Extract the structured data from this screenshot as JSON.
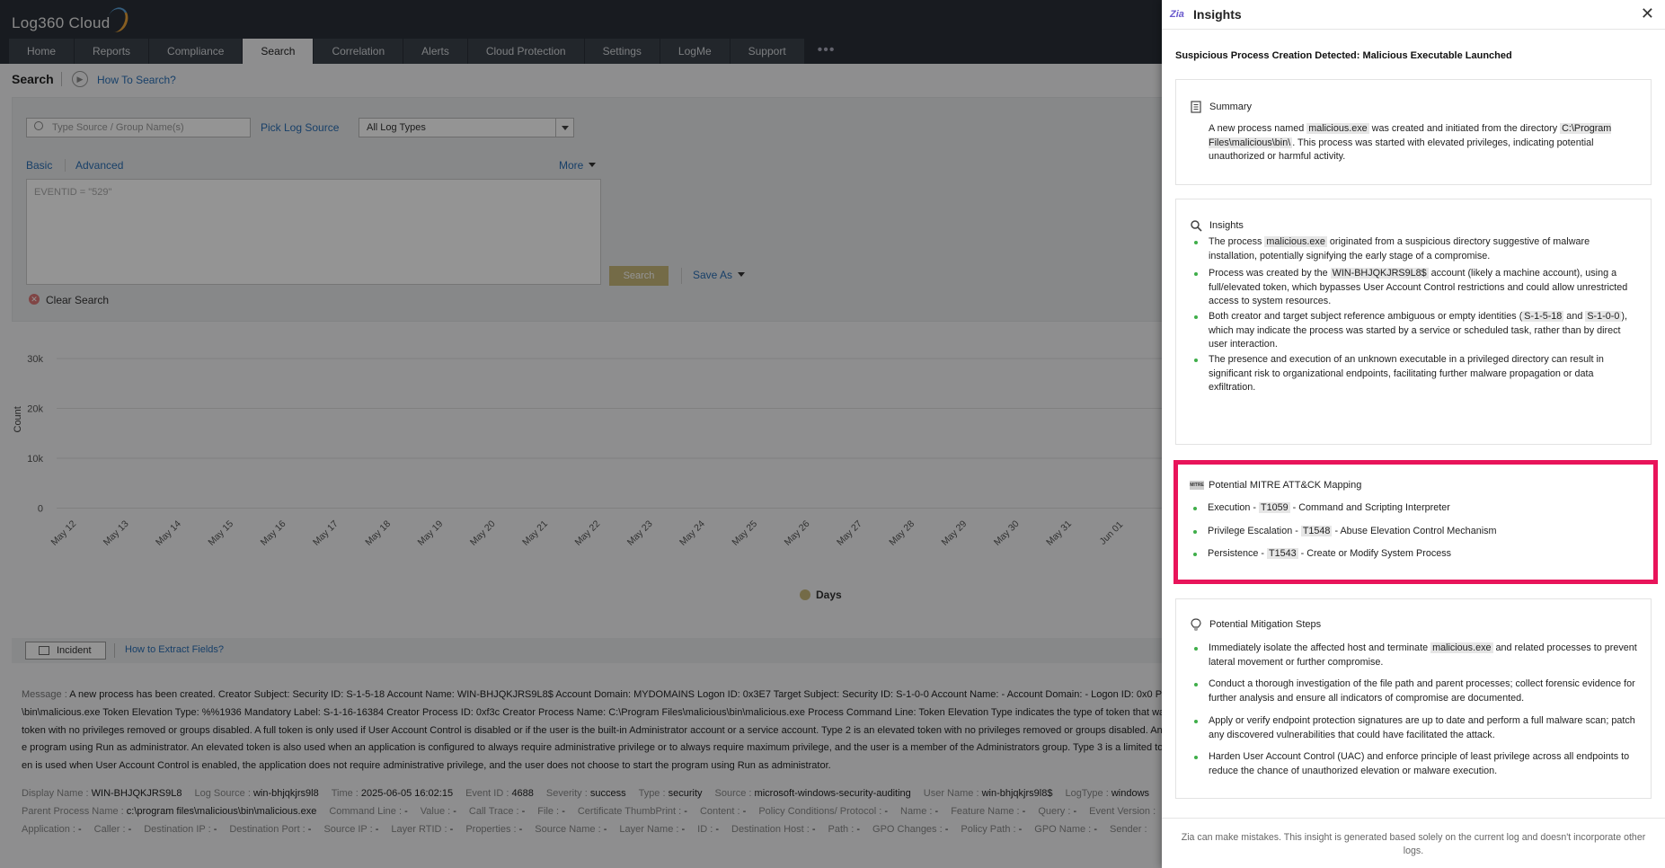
{
  "app": {
    "logo": "Log360 Cloud",
    "nav": [
      "Home",
      "Reports",
      "Compliance",
      "Search",
      "Correlation",
      "Alerts",
      "Cloud Protection",
      "Settings",
      "LogMe",
      "Support"
    ],
    "active_nav": "Search",
    "page_title": "Search",
    "how_to_search": "How To Search?"
  },
  "search": {
    "source_placeholder": "Type Source / Group Name(s)",
    "pick_log_source": "Pick Log Source",
    "log_type": "All Log Types",
    "mode_basic": "Basic",
    "mode_advanced": "Advanced",
    "more": "More",
    "query": "EVENTID = \"529\"",
    "search_button": "Search",
    "save_as": "Save As",
    "clear_search": "Clear Search"
  },
  "chart_data": {
    "type": "line",
    "ylabel": "Count",
    "xlabel": "Days",
    "ylim": [
      0,
      30000
    ],
    "yticks": [
      "30k",
      "20k",
      "10k",
      "0"
    ],
    "categories": [
      "May 12",
      "May 13",
      "May 14",
      "May 15",
      "May 16",
      "May 17",
      "May 18",
      "May 19",
      "May 20",
      "May 21",
      "May 22",
      "May 23",
      "May 24",
      "May 25",
      "May 26",
      "May 27",
      "May 28",
      "May 29",
      "May 30",
      "May 31",
      "Jun 01"
    ],
    "legend": [
      "Days"
    ],
    "grid": true
  },
  "incident": {
    "button": "Incident",
    "extract_link": "How to Extract Fields?"
  },
  "log": {
    "message_key": "Message",
    "message_lines": [
      "A new process has been created. Creator Subject: Security ID: S-1-5-18 Account Name: WIN-BHJQKJRS9L8$ Account Domain: MYDOMAINS Logon ID: 0x3E7 Target Subject: Security ID: S-1-0-0 Account Name: - Account Domain: - Logon ID: 0x0 P",
      "\\bin\\malicious.exe Token Elevation Type: %%1936 Mandatory Label: S-1-16-16384 Creator Process ID: 0xf3c Creator Process Name: C:\\Program Files\\malicious\\bin\\malicious.exe Process Command Line: Token Elevation Type indicates the type of token that wa",
      "token with no privileges removed or groups disabled. A full token is only used if User Account Control is disabled or if the user is the built-in Administrator account or a service account. Type 2 is an elevated token with no privileges removed or groups disabled. An",
      "e program using Run as administrator. An elevated token is also used when an application is configured to always require administrative privilege or to always require maximum privilege, and the user is a member of the Administrators group. Type 3 is a limited to",
      "en is used when User Account Control is enabled, the application does not require administrative privilege, and the user does not choose to start the program using Run as administrator."
    ],
    "fields_row1": [
      [
        "Display Name",
        "WIN-BHJQKJRS9L8"
      ],
      [
        "Log Source",
        "win-bhjqkjrs9l8"
      ],
      [
        "Time",
        "2025-06-05 16:02:15"
      ],
      [
        "Event ID",
        "4688"
      ],
      [
        "Severity",
        "success"
      ],
      [
        "Type",
        "security"
      ],
      [
        "Source",
        "microsoft-windows-security-auditing"
      ],
      [
        "User Name",
        "win-bhjqkjrs9l8$"
      ],
      [
        "LogType",
        "windows"
      ]
    ],
    "fields_row2": [
      [
        "Parent Process Name",
        "c:\\program files\\malicious\\bin\\malicious.exe"
      ],
      [
        "Command Line",
        "-"
      ],
      [
        "Value",
        "-"
      ],
      [
        "Call Trace",
        "-"
      ],
      [
        "File",
        "-"
      ],
      [
        "Certificate ThumbPrint",
        "-"
      ],
      [
        "Content",
        "-"
      ],
      [
        "Policy Conditions/ Protocol",
        "-"
      ],
      [
        "Name",
        "-"
      ],
      [
        "Feature Name",
        "-"
      ],
      [
        "Query",
        "-"
      ],
      [
        "Event Version",
        ""
      ]
    ],
    "fields_row3": [
      [
        "Application",
        "-"
      ],
      [
        "Caller",
        "-"
      ],
      [
        "Destination IP",
        "-"
      ],
      [
        "Destination Port",
        "-"
      ],
      [
        "Source IP",
        "-"
      ],
      [
        "Layer RTID",
        "-"
      ],
      [
        "Properties",
        "-"
      ],
      [
        "Source Name",
        "-"
      ],
      [
        "Layer Name",
        "-"
      ],
      [
        "ID",
        "-"
      ],
      [
        "Destination Host",
        "-"
      ],
      [
        "Path",
        "-"
      ],
      [
        "GPO Changes",
        "-"
      ],
      [
        "Policy Path",
        "-"
      ],
      [
        "GPO Name",
        "-"
      ],
      [
        "Sender",
        ""
      ]
    ]
  },
  "insights": {
    "zia_icon": "Zia",
    "title": "Insights",
    "heading": "Suspicious Process Creation Detected: Malicious Executable Launched",
    "summary": {
      "title": "Summary",
      "text_parts": [
        "A new process named ",
        "malicious.exe",
        " was created and initiated from the directory ",
        "C:\\Program Files\\malicious\\bin\\",
        ". This process was started with elevated privileges, indicating potential unauthorized or harmful activity."
      ]
    },
    "insights_card": {
      "title": "Insights",
      "bullets": [
        [
          "The process ",
          "malicious.exe",
          " originated from a suspicious directory suggestive of malware installation, potentially signifying the early stage of a compromise."
        ],
        [
          "Process was created by the ",
          "WIN-BHJQKJRS9L8$",
          " account (likely a machine account), using a full/elevated token, which bypasses User Account Control restrictions and could allow unrestricted access to system resources."
        ],
        [
          "Both creator and target subject reference ambiguous or empty identities (",
          "S-1-5-18",
          " and ",
          "S-1-0-0",
          "), which may indicate the process was started by a service or scheduled task, rather than by direct user interaction."
        ],
        [
          "The presence and execution of an unknown executable in a privileged directory can result in significant risk to organizational endpoints, facilitating further malware propagation or data exfiltration."
        ]
      ]
    },
    "mitre": {
      "title": "Potential MITRE ATT&CK Mapping",
      "icon_text": "MITRE",
      "items": [
        [
          "Execution - ",
          "T1059",
          " - Command and Scripting Interpreter"
        ],
        [
          "Privilege Escalation - ",
          "T1548",
          " - Abuse Elevation Control Mechanism"
        ],
        [
          "Persistence - ",
          "T1543",
          " - Create or Modify System Process"
        ]
      ]
    },
    "mitigation": {
      "title": "Potential Mitigation Steps",
      "bullets": [
        [
          "Immediately isolate the affected host and terminate ",
          "malicious.exe",
          " and related processes to prevent lateral movement or further compromise."
        ],
        [
          "Conduct a thorough investigation of the file path and parent processes; collect forensic evidence for further analysis and ensure all indicators of compromise are documented."
        ],
        [
          "Apply or verify endpoint protection signatures are up to date and perform a full malware scan; patch any discovered vulnerabilities that could have facilitated the attack."
        ],
        [
          "Harden User Account Control (UAC) and enforce principle of least privilege across all endpoints to reduce the chance of unauthorized elevation or malware execution."
        ]
      ]
    },
    "footer": "Zia can make mistakes. This insight is generated based solely on the current log and doesn't incorporate other logs.",
    "colors": {
      "bullet": "#3fae49",
      "highlight_border": "#e8145a",
      "zia": "#6a5acd"
    }
  }
}
